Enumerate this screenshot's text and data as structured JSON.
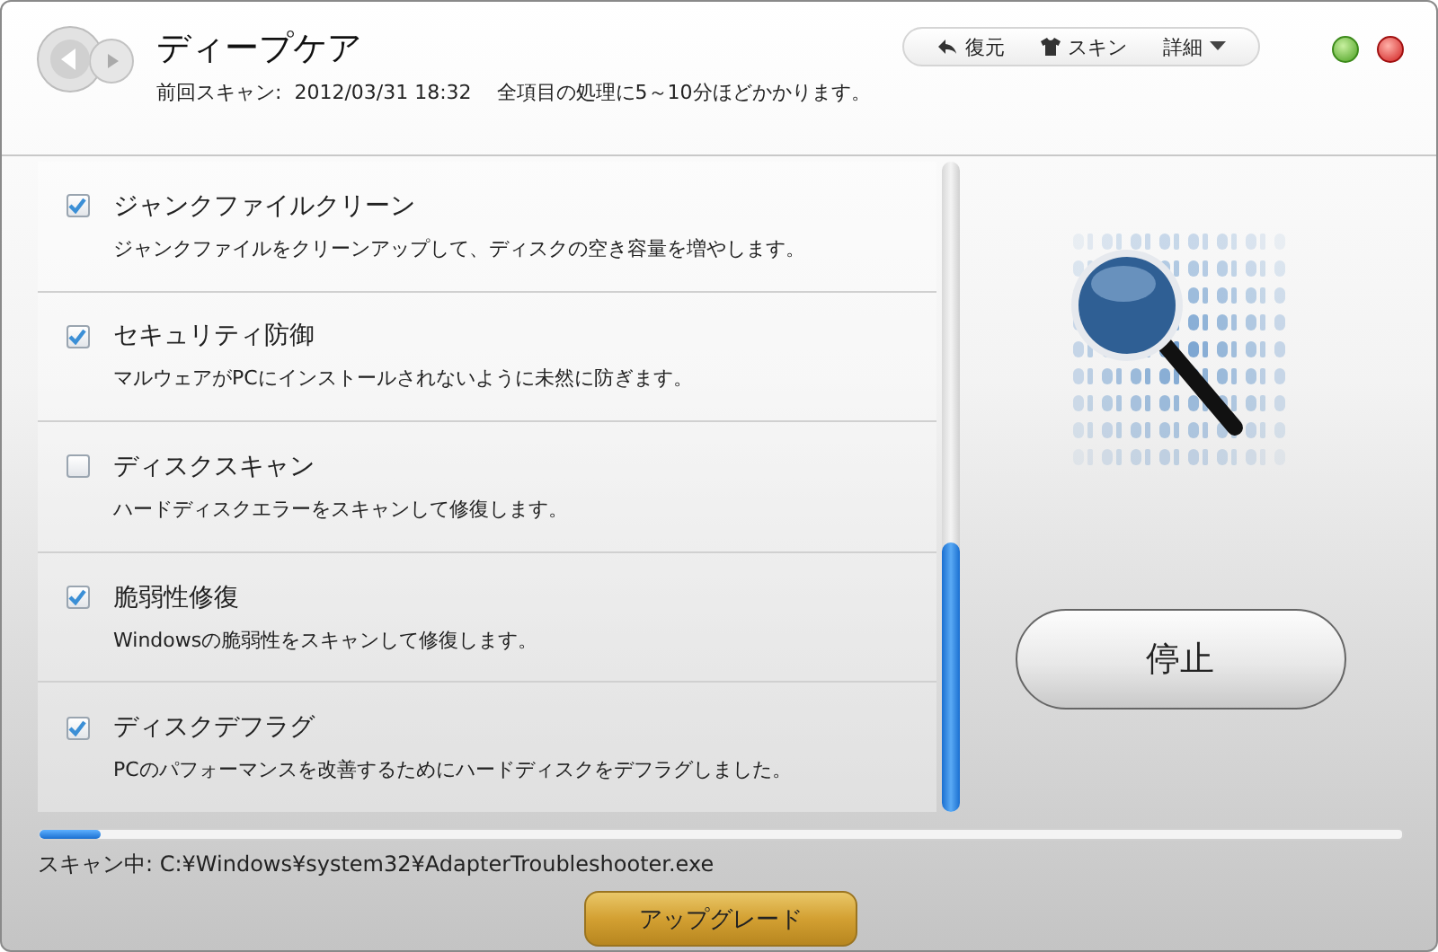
{
  "window": {
    "title": "ディープケア",
    "subtitle": "前回スキャン:  2012/03/31 18:32    全項目の処理に5～10分ほどかかります。"
  },
  "toolbar": [
    {
      "kind": "restore",
      "label": "復元"
    },
    {
      "kind": "skin",
      "label": "スキン"
    },
    {
      "kind": "menu",
      "label": "詳細"
    }
  ],
  "items": [
    {
      "title": "ジャンクファイルクリーン",
      "description": "ジャンクファイルをクリーンアップして、ディスクの空き容量を増やします。",
      "checked": true
    },
    {
      "title": "セキュリティ防御",
      "description": "マルウェアがPCにインストールされないように未然に防ぎます。",
      "checked": true
    },
    {
      "title": "ディスクスキャン",
      "description": "ハードディスクエラーをスキャンして修復します。",
      "checked": false
    },
    {
      "title": "脆弱性修復",
      "description": "Windowsの脆弱性をスキャンして修復します。",
      "checked": true
    },
    {
      "title": "ディスクデフラグ",
      "description": "PCのパフォーマンスを改善するためにハードディスクをデフラグしました。",
      "checked": true
    }
  ],
  "stop_button": "停止",
  "progress": {
    "level": 0.045,
    "status": "スキャン中: C:¥Windows¥system32¥AdapterTroubleshooter.exe"
  },
  "upgrade_button": "アップグレード"
}
